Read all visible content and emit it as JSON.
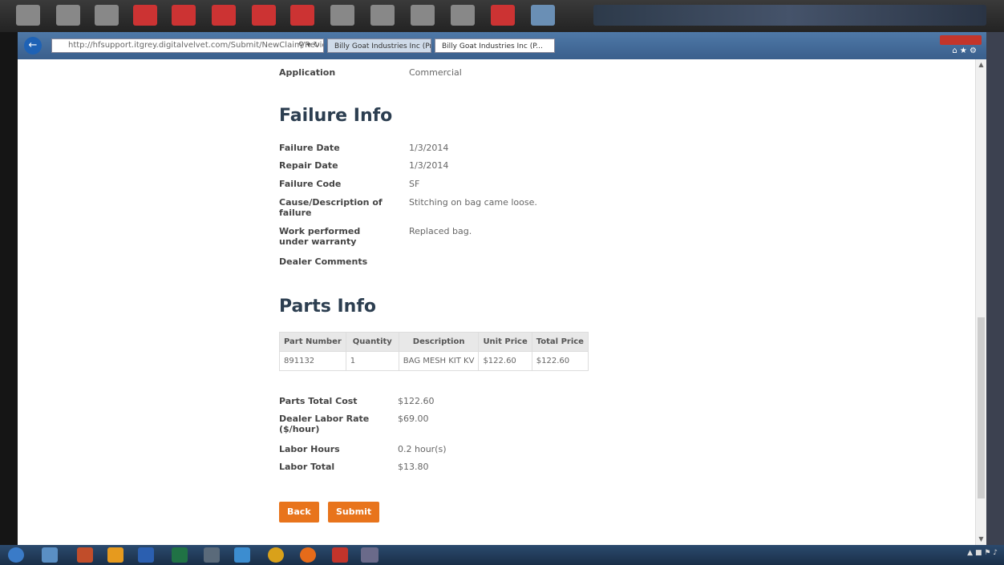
{
  "browser": {
    "address": "http://hfsupport.itgrey.digitalvelvet.com/Submit/NewClaim/Review",
    "tab1_label": "Billy Goat Industries Inc (Prod...",
    "tab2_label": "Billy Goat Industries Inc (P..."
  },
  "application": {
    "label": "Application",
    "value": "Commercial"
  },
  "failure_info": {
    "heading": "Failure Info",
    "failure_date": {
      "label": "Failure Date",
      "value": "1/3/2014"
    },
    "repair_date": {
      "label": "Repair Date",
      "value": "1/3/2014"
    },
    "failure_code": {
      "label": "Failure Code",
      "value": "SF"
    },
    "cause": {
      "label": "Cause/Description of failure",
      "value": "Stitching on bag came loose."
    },
    "work": {
      "label": "Work performed under warranty",
      "value": "Replaced bag."
    },
    "dealer_comments": {
      "label": "Dealer Comments",
      "value": ""
    }
  },
  "parts_info": {
    "heading": "Parts Info",
    "columns": [
      "Part Number",
      "Quantity",
      "Description",
      "Unit Price",
      "Total Price"
    ],
    "rows": [
      [
        "891132",
        "1",
        "BAG MESH KIT KV",
        "$122.60",
        "$122.60"
      ]
    ]
  },
  "totals": {
    "parts_total": {
      "label": "Parts Total Cost",
      "value": "$122.60"
    },
    "labor_rate": {
      "label": "Dealer Labor Rate ($/hour)",
      "value": "$69.00"
    },
    "labor_hours": {
      "label": "Labor Hours",
      "value": "0.2 hour(s)"
    },
    "labor_total": {
      "label": "Labor Total",
      "value": "$13.80"
    }
  },
  "buttons": {
    "back": "Back",
    "submit": "Submit"
  },
  "colors": {
    "accent": "#e8741c",
    "heading": "#2c3e50"
  }
}
